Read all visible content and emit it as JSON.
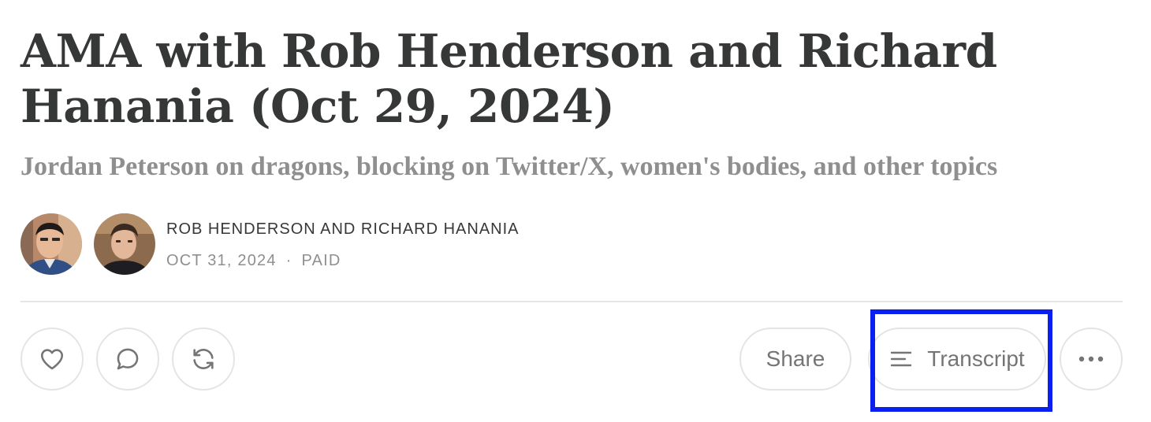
{
  "post": {
    "title": "AMA with Rob Henderson and Richard Hanania (Oct 29, 2024)",
    "subtitle": "Jordan Peterson on dragons, blocking on Twitter/X, women's bodies, and other topics",
    "authors": "ROB HENDERSON AND RICHARD HANANIA",
    "date": "OCT 31, 2024",
    "separator": "·",
    "access": "PAID"
  },
  "actions": {
    "like_icon": "heart-icon",
    "comment_icon": "comment-icon",
    "restack_icon": "restack-icon",
    "share_label": "Share",
    "transcript_label": "Transcript",
    "transcript_icon": "lines-icon",
    "more_icon": "ellipsis-icon"
  },
  "colors": {
    "text_primary": "#363737",
    "text_muted": "#8f8f8f",
    "border": "#e4e4e4",
    "highlight": "#0a1ff0"
  }
}
